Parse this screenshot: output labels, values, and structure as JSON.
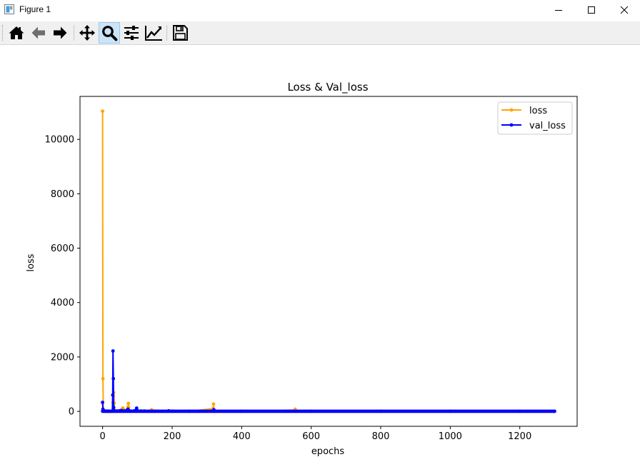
{
  "window": {
    "title": "Figure 1",
    "controls": [
      "minimize-icon",
      "maximize-icon",
      "close-icon"
    ]
  },
  "toolbar": {
    "items": [
      "home-icon",
      "back-arrow-icon",
      "forward-arrow-icon",
      "pan-move-icon",
      "zoom-magnifier-icon",
      "configure-subplots-icon",
      "edit-axis-lines-icon",
      "save-floppy-icon"
    ],
    "active": "zoom-magnifier-icon"
  },
  "chart_data": {
    "type": "line",
    "title": "Loss & Val_loss",
    "xlabel": "epochs",
    "ylabel": "loss",
    "xlim": [
      -65,
      1365
    ],
    "ylim": [
      -550,
      11580
    ],
    "xticks": [
      0,
      200,
      400,
      600,
      800,
      1000,
      1200
    ],
    "yticks": [
      0,
      2000,
      4000,
      6000,
      8000,
      10000
    ],
    "grid": false,
    "legend_position": "upper right",
    "x_max": 1300,
    "series": [
      {
        "name": "loss",
        "color": "#ffa500",
        "marker": "dot",
        "points": [
          [
            0,
            11040
          ],
          [
            1,
            1200
          ],
          [
            2,
            60
          ],
          [
            3,
            25
          ],
          [
            5,
            12
          ],
          [
            10,
            8
          ],
          [
            15,
            6
          ],
          [
            20,
            5
          ],
          [
            25,
            5
          ],
          [
            28,
            6
          ],
          [
            30,
            320
          ],
          [
            31,
            560
          ],
          [
            32,
            690
          ],
          [
            33,
            300
          ],
          [
            34,
            40
          ],
          [
            35,
            10
          ],
          [
            40,
            8
          ],
          [
            45,
            15
          ],
          [
            50,
            12
          ],
          [
            55,
            60
          ],
          [
            58,
            120
          ],
          [
            60,
            90
          ],
          [
            62,
            20
          ],
          [
            65,
            15
          ],
          [
            70,
            30
          ],
          [
            73,
            160
          ],
          [
            74,
            290
          ],
          [
            75,
            150
          ],
          [
            76,
            20
          ],
          [
            80,
            10
          ],
          [
            90,
            8
          ],
          [
            100,
            20
          ],
          [
            110,
            15
          ],
          [
            120,
            8
          ],
          [
            140,
            40
          ],
          [
            141,
            60
          ],
          [
            142,
            10
          ],
          [
            160,
            8
          ],
          [
            190,
            8
          ],
          [
            250,
            6
          ],
          [
            318,
            100
          ],
          [
            319,
            270
          ],
          [
            320,
            60
          ],
          [
            321,
            8
          ],
          [
            400,
            5
          ],
          [
            553,
            50
          ],
          [
            554,
            75
          ],
          [
            555,
            10
          ],
          [
            700,
            4
          ],
          [
            900,
            4
          ],
          [
            1100,
            4
          ],
          [
            1300,
            4
          ]
        ]
      },
      {
        "name": "val_loss",
        "color": "#0000ff",
        "marker": "dot",
        "points": [
          [
            0,
            330
          ],
          [
            1,
            80
          ],
          [
            2,
            20
          ],
          [
            3,
            12
          ],
          [
            5,
            9
          ],
          [
            10,
            7
          ],
          [
            15,
            6
          ],
          [
            20,
            5
          ],
          [
            25,
            5
          ],
          [
            28,
            10
          ],
          [
            29,
            600
          ],
          [
            30,
            2220
          ],
          [
            31,
            1200
          ],
          [
            32,
            140
          ],
          [
            33,
            15
          ],
          [
            35,
            8
          ],
          [
            40,
            10
          ],
          [
            45,
            12
          ],
          [
            50,
            25
          ],
          [
            55,
            30
          ],
          [
            60,
            10
          ],
          [
            65,
            15
          ],
          [
            70,
            40
          ],
          [
            73,
            80
          ],
          [
            75,
            20
          ],
          [
            80,
            10
          ],
          [
            90,
            15
          ],
          [
            98,
            120
          ],
          [
            100,
            30
          ],
          [
            110,
            10
          ],
          [
            120,
            8
          ],
          [
            150,
            6
          ],
          [
            190,
            20
          ],
          [
            200,
            6
          ],
          [
            250,
            5
          ],
          [
            318,
            8
          ],
          [
            320,
            60
          ],
          [
            322,
            6
          ],
          [
            400,
            4
          ],
          [
            600,
            4
          ],
          [
            800,
            4
          ],
          [
            1000,
            3
          ],
          [
            1200,
            3
          ],
          [
            1300,
            3
          ]
        ]
      }
    ]
  }
}
